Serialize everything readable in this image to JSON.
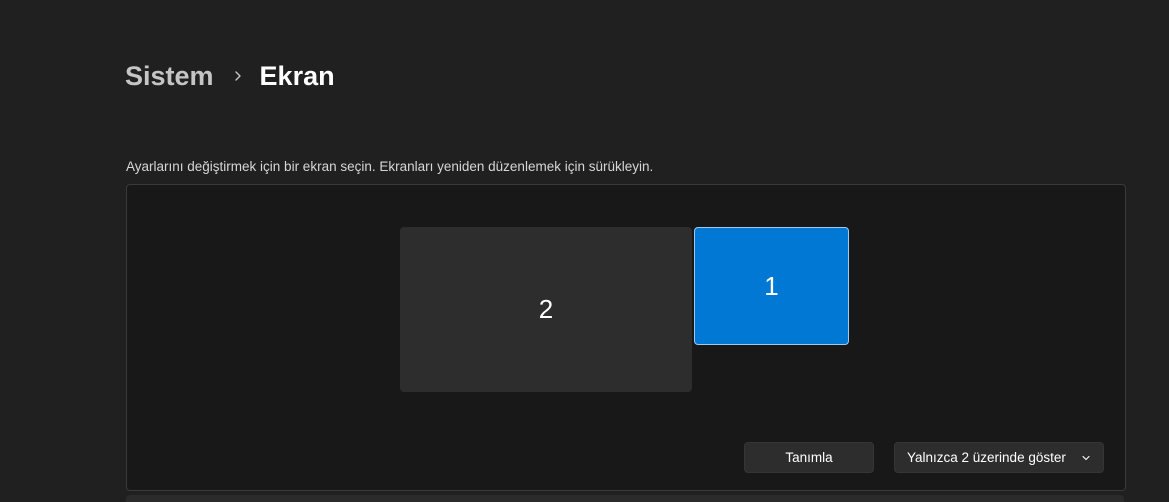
{
  "breadcrumb": {
    "parent": "Sistem",
    "current": "Ekran"
  },
  "instructions": "Ayarlarını değiştirmek için bir ekran seçin. Ekranları yeniden düzenlemek için sürükleyin.",
  "displays": {
    "monitor_2_label": "2",
    "monitor_1_label": "1",
    "selected": "1"
  },
  "actions": {
    "identify_label": "Tanımla",
    "mode_dropdown_value": "Yalnızca 2 üzerinde göster"
  },
  "colors": {
    "background": "#202020",
    "panel": "#181818",
    "selected_monitor": "#0078d4",
    "unselected_monitor": "#2d2d2d"
  },
  "icons": {
    "breadcrumb_separator": "chevron-right-icon",
    "dropdown": "chevron-down-icon"
  }
}
